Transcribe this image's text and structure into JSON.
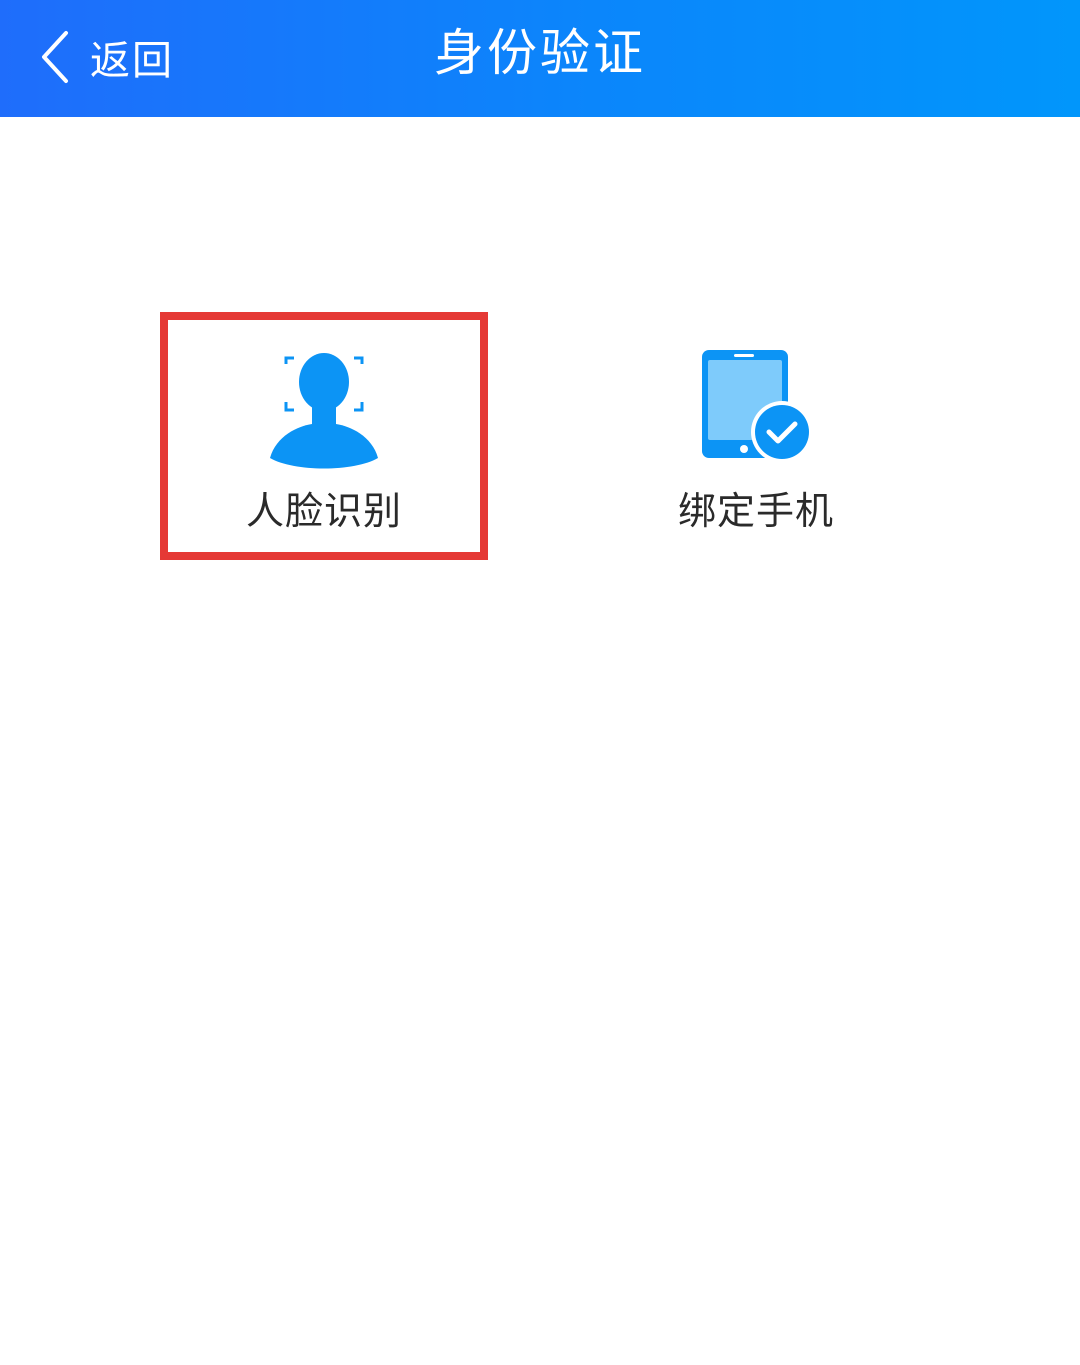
{
  "header": {
    "back_label": "返回",
    "title": "身份验证",
    "back_icon": "chevron-left-icon"
  },
  "options": [
    {
      "label": "人脸识别",
      "icon": "face-recognition-icon",
      "highlighted": true
    },
    {
      "label": "绑定手机",
      "icon": "phone-bind-icon",
      "highlighted": false
    }
  ],
  "colors": {
    "header_start": "#1f6dfb",
    "header_end": "#0196fb",
    "icon_blue": "#0c94f5",
    "icon_light_blue": "#7ecbfb",
    "highlight_border": "#e53935",
    "label_text": "#2a2a2a"
  }
}
